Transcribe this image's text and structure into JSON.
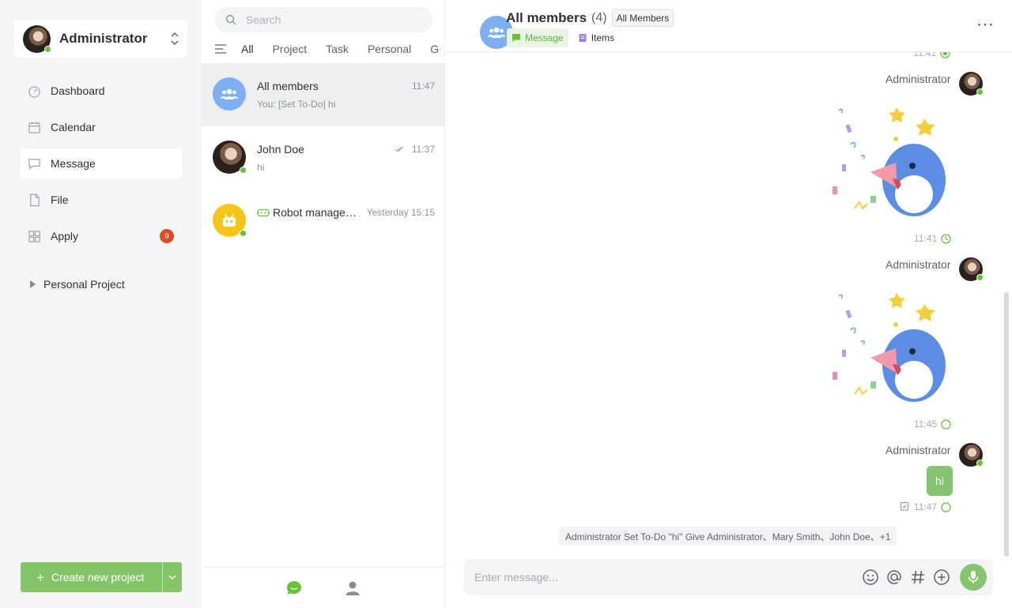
{
  "user": {
    "name": "Administrator"
  },
  "nav": {
    "dashboard": "Dashboard",
    "calendar": "Calendar",
    "message": "Message",
    "file": "File",
    "apply": "Apply",
    "apply_badge": "9"
  },
  "project_section": "Personal Project",
  "create_button": {
    "plus": "+",
    "label": "Create new project"
  },
  "search": {
    "placeholder": "Search"
  },
  "filter_tabs": [
    "All",
    "Project",
    "Task",
    "Personal",
    "G"
  ],
  "conversations": [
    {
      "name": "All members",
      "time": "11:47",
      "preview": "You: [Set To-Do] hi"
    },
    {
      "name": "John Doe",
      "time": "11:37",
      "preview": "hi"
    },
    {
      "name": "Robot manage…",
      "time": "Yesterday 15:15",
      "preview": ""
    }
  ],
  "chat": {
    "title": "All members",
    "count": "(4)",
    "tag": "All Members",
    "tab_message": "Message",
    "tab_items": "Items",
    "more": "⋯"
  },
  "messages": {
    "top_time": "11:41",
    "sender": "Administrator",
    "time1": "11:41",
    "time2": "11:45",
    "bubble": "hi",
    "time3": "11:47"
  },
  "notice": "Administrator Set To-Do \"hi\" Give Administrator、Mary Smith、John Doe、+1",
  "input": {
    "placeholder": "Enter message..."
  },
  "colors": {
    "accent": "#85c570",
    "badge": "#e04a25",
    "group_avatar": "#7eaff2",
    "robot_avatar": "#f5c518"
  }
}
